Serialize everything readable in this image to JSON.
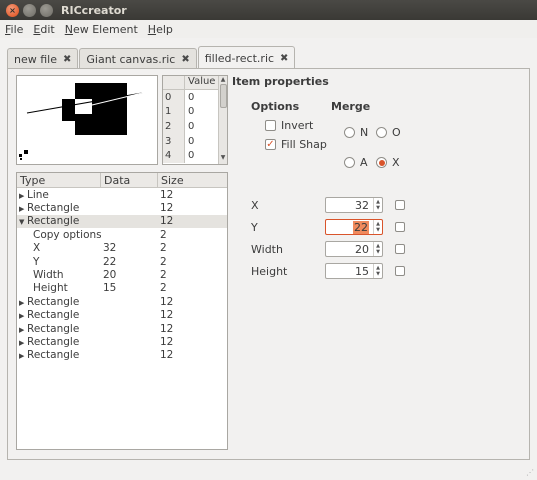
{
  "window": {
    "title": "RICcreator"
  },
  "menu": [
    "File",
    "Edit",
    "New Element",
    "Help"
  ],
  "tabs": [
    {
      "label": "new file",
      "active": false
    },
    {
      "label": "Giant canvas.ric",
      "active": false
    },
    {
      "label": "filled-rect.ric",
      "active": true
    }
  ],
  "value_table": {
    "header": "Value",
    "rows": [
      {
        "index": "0",
        "value": "0"
      },
      {
        "index": "1",
        "value": "0"
      },
      {
        "index": "2",
        "value": "0"
      },
      {
        "index": "3",
        "value": "0"
      },
      {
        "index": "4",
        "value": "0"
      }
    ]
  },
  "tree": {
    "columns": [
      "Type",
      "Data",
      "Size"
    ],
    "rows": [
      {
        "type": "Line",
        "data": "",
        "size": "12",
        "level": 0,
        "expander": "collapsed"
      },
      {
        "type": "Rectangle",
        "data": "",
        "size": "12",
        "level": 0,
        "expander": "collapsed"
      },
      {
        "type": "Rectangle",
        "data": "",
        "size": "12",
        "level": 0,
        "expander": "expanded",
        "selected": true
      },
      {
        "type": "Copy options",
        "data": "",
        "size": "2",
        "level": 1,
        "expander": "none"
      },
      {
        "type": "X",
        "data": "32",
        "size": "2",
        "level": 1,
        "expander": "none"
      },
      {
        "type": "Y",
        "data": "22",
        "size": "2",
        "level": 1,
        "expander": "none"
      },
      {
        "type": "Width",
        "data": "20",
        "size": "2",
        "level": 1,
        "expander": "none"
      },
      {
        "type": "Height",
        "data": "15",
        "size": "2",
        "level": 1,
        "expander": "none"
      },
      {
        "type": "Rectangle",
        "data": "",
        "size": "12",
        "level": 0,
        "expander": "collapsed"
      },
      {
        "type": "Rectangle",
        "data": "",
        "size": "12",
        "level": 0,
        "expander": "collapsed"
      },
      {
        "type": "Rectangle",
        "data": "",
        "size": "12",
        "level": 0,
        "expander": "collapsed"
      },
      {
        "type": "Rectangle",
        "data": "",
        "size": "12",
        "level": 0,
        "expander": "collapsed"
      },
      {
        "type": "Rectangle",
        "data": "",
        "size": "12",
        "level": 0,
        "expander": "collapsed"
      }
    ]
  },
  "props": {
    "heading": "Item properties",
    "options_title": "Options",
    "merge_title": "Merge",
    "invert_label": "Invert",
    "invert_checked": false,
    "fill_label": "Fill Shap",
    "fill_checked": true,
    "merge_n": "N",
    "merge_o": "O",
    "merge_a": "A",
    "merge_x": "X",
    "merge_selected": "X",
    "x_label": "X",
    "x_value": "32",
    "y_label": "Y",
    "y_value": "22",
    "width_label": "Width",
    "width_value": "20",
    "height_label": "Height",
    "height_value": "15"
  },
  "colors": {
    "accent": "#d9542b",
    "window_bg": "#f2f1f0",
    "titlebar": "#3c3b37"
  }
}
